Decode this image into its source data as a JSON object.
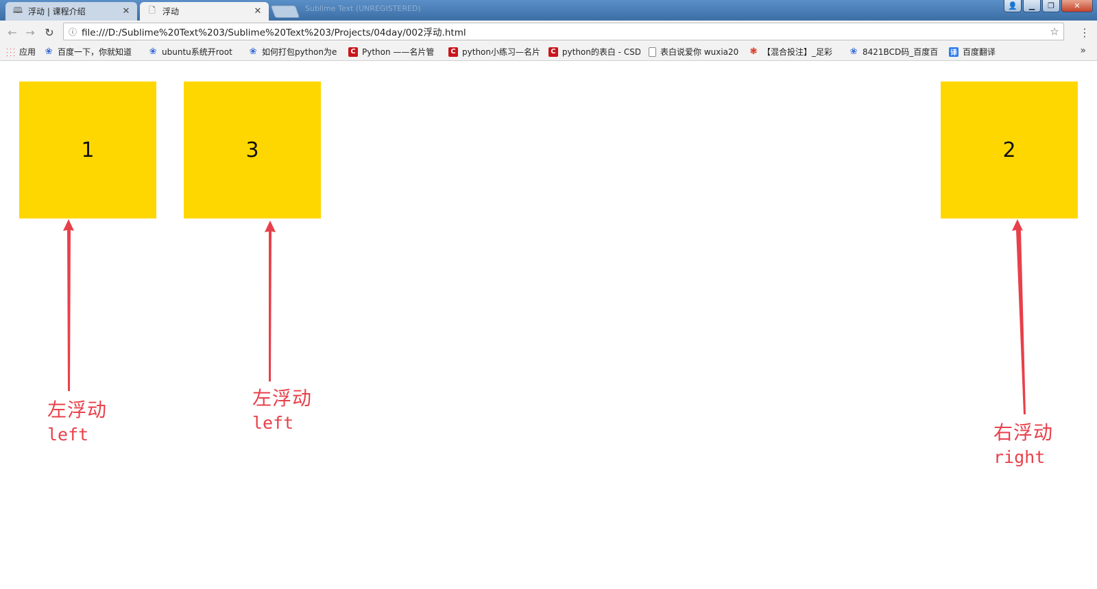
{
  "tabs": [
    {
      "label": "浮动 | 课程介绍",
      "icon": "book-icon"
    },
    {
      "label": "浮动",
      "icon": "page-icon"
    }
  ],
  "ghost_title": "Sublime Text (UNREGISTERED)",
  "address": {
    "url": "file:///D:/Sublime%20Text%203/Sublime%20Text%203/Projects/04day/002浮动.html"
  },
  "bookmarks": [
    {
      "label": "应用",
      "icon": "apps-icon"
    },
    {
      "label": "百度一下，你就知道",
      "icon": "paw-icon"
    },
    {
      "label": "ubuntu系统开root",
      "icon": "paw-icon"
    },
    {
      "label": "如何打包python为e",
      "icon": "paw-icon"
    },
    {
      "label": "Python ——名片管",
      "icon": "csdn-icon"
    },
    {
      "label": "python小练习—名片",
      "icon": "csdn-icon"
    },
    {
      "label": "python的表白 - CSD",
      "icon": "csdn-icon"
    },
    {
      "label": "表白说爱你 wuxia20",
      "icon": "doc-icon"
    },
    {
      "label": "【混合投注】_足彩",
      "icon": "lottery-icon"
    },
    {
      "label": "8421BCD码_百度百",
      "icon": "paw-icon"
    },
    {
      "label": "百度翻译",
      "icon": "translate-icon"
    }
  ],
  "boxes": {
    "box1": "1",
    "box3": "3",
    "box2": "2"
  },
  "annotations": {
    "a1": {
      "zh": "左浮动",
      "en": "left"
    },
    "a3": {
      "zh": "左浮动",
      "en": "left"
    },
    "a2": {
      "zh": "右浮动",
      "en": "right"
    }
  },
  "colors": {
    "box": "#ffd700",
    "annotation": "#e8404a"
  }
}
